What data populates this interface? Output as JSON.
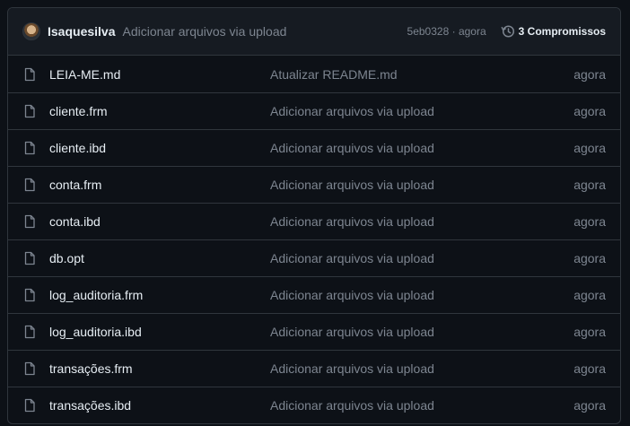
{
  "latest_commit": {
    "author": "Isaquesilva",
    "message": "Adicionar arquivos via upload",
    "sha": "5eb0328",
    "separator": "·",
    "age": "agora",
    "history_label": "3 Compromissos"
  },
  "colors": {
    "background": "#0d1117",
    "header_background": "#161b22",
    "border": "#30363d",
    "text_primary": "#e6edf3",
    "text_muted": "#7d8590"
  },
  "files": [
    {
      "name": "LEIA-ME.md",
      "commit_message": "Atualizar README.md",
      "age": "agora",
      "icon": "file-icon"
    },
    {
      "name": "cliente.frm",
      "commit_message": "Adicionar arquivos via upload",
      "age": "agora",
      "icon": "file-icon"
    },
    {
      "name": "cliente.ibd",
      "commit_message": "Adicionar arquivos via upload",
      "age": "agora",
      "icon": "file-icon"
    },
    {
      "name": "conta.frm",
      "commit_message": "Adicionar arquivos via upload",
      "age": "agora",
      "icon": "file-icon"
    },
    {
      "name": "conta.ibd",
      "commit_message": "Adicionar arquivos via upload",
      "age": "agora",
      "icon": "file-icon"
    },
    {
      "name": "db.opt",
      "commit_message": "Adicionar arquivos via upload",
      "age": "agora",
      "icon": "file-icon"
    },
    {
      "name": "log_auditoria.frm",
      "commit_message": "Adicionar arquivos via upload",
      "age": "agora",
      "icon": "file-icon"
    },
    {
      "name": "log_auditoria.ibd",
      "commit_message": "Adicionar arquivos via upload",
      "age": "agora",
      "icon": "file-icon"
    },
    {
      "name": "transações.frm",
      "commit_message": "Adicionar arquivos via upload",
      "age": "agora",
      "icon": "file-icon"
    },
    {
      "name": "transações.ibd",
      "commit_message": "Adicionar arquivos via upload",
      "age": "agora",
      "icon": "file-icon"
    }
  ]
}
